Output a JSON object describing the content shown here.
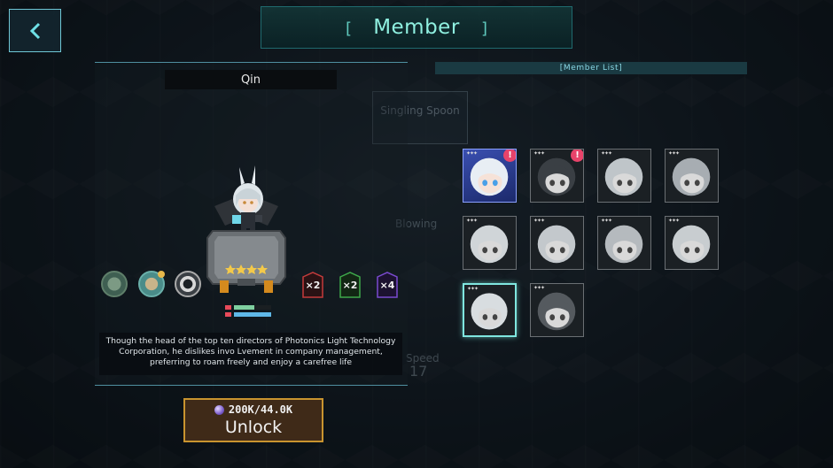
{
  "header": {
    "title": "Member"
  },
  "character": {
    "name": "Qin",
    "description": "Though the head of the top ten directors of Photonics Light Technology Corporation, he dislikes invo Lvement in company management, preferring to roam freely and enjoy a carefree life",
    "stars": 4,
    "badges": [
      {
        "label": "×2",
        "color": "#c43b3b"
      },
      {
        "label": "×2",
        "color": "#3ea84a"
      },
      {
        "label": "×4",
        "color": "#7a4ad0"
      }
    ],
    "stat_colors": {
      "hp": "#e84a5a",
      "bar1": "#7fd0a0",
      "bar2": "#5fb8e8"
    }
  },
  "unlock": {
    "cost": "200K/44.0K",
    "label": "Unlock"
  },
  "member_list": {
    "title": "[Member List]",
    "alert_symbol": "!",
    "members": [
      {
        "id": "m1",
        "state": "active",
        "alert": true
      },
      {
        "id": "m2",
        "state": "locked",
        "alert": true
      },
      {
        "id": "m3",
        "state": "locked",
        "alert": false
      },
      {
        "id": "m4",
        "state": "locked",
        "alert": false
      },
      {
        "id": "m5",
        "state": "locked",
        "alert": false
      },
      {
        "id": "m6",
        "state": "locked",
        "alert": false
      },
      {
        "id": "m7",
        "state": "locked",
        "alert": false
      },
      {
        "id": "m8",
        "state": "locked",
        "alert": false
      },
      {
        "id": "m9",
        "state": "selected",
        "alert": false
      },
      {
        "id": "m10",
        "state": "locked",
        "alert": false
      }
    ]
  },
  "background_faded_text": {
    "card_title": "Singling Spoon",
    "label_a": "Blowing",
    "label_b": "Speed",
    "label_c": "17"
  }
}
